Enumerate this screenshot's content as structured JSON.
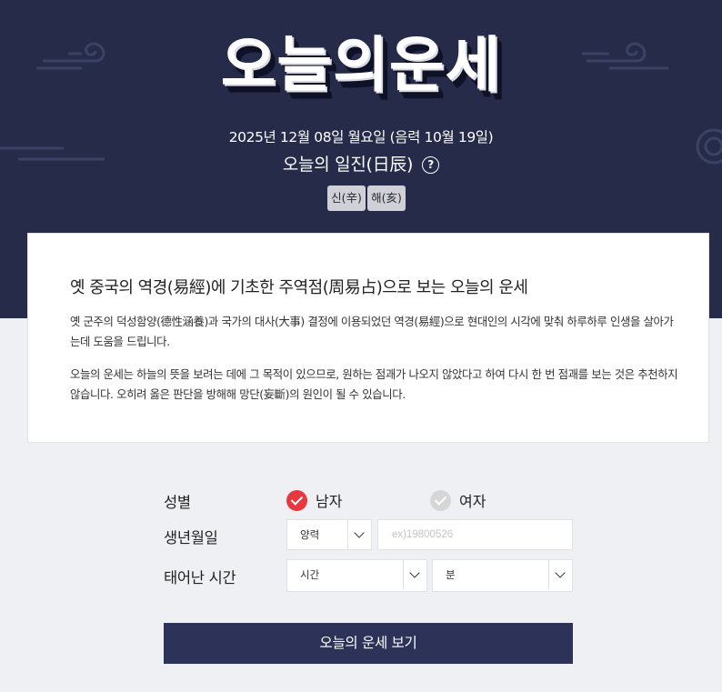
{
  "header": {
    "title": "오늘의운세",
    "date_line": "2025년 12월 08일 월요일 (음력 10월 19일)",
    "iljin_label": "오늘의 일진(日辰)",
    "help_icon": "question-circle-icon",
    "chips": [
      "신(辛)",
      "해(亥)"
    ]
  },
  "info": {
    "heading": "옛 중국의 역경(易經)에 기초한 주역점(周易占)으로 보는 오늘의 운세",
    "paragraph1": "옛 군주의 덕성함양(德性涵養)과 국가의 대사(大事) 결정에 이용되었던 역경(易經)으로 현대인의 시각에 맞춰 하루하루 인생을 살아가는데 도움을 드립니다.",
    "paragraph2": "오늘의 운세는 하늘의 뜻을 보려는 데에 그 목적이 있으므로, 원하는 점괘가 나오지 않았다고 하여 다시 한 번 점괘를 보는 것은 추천하지 않습니다. 오히려 옳은 판단을 방해해 망단(妄斷)의 원인이 될 수 있습니다."
  },
  "form": {
    "gender_label": "성별",
    "male_label": "남자",
    "female_label": "여자",
    "selected_gender": "남자",
    "birth_label": "생년월일",
    "calendar_select": "양력",
    "birth_placeholder": "ex)19800526",
    "time_label": "태어난 시간",
    "hour_select": "시간",
    "minute_select": "분",
    "submit_label": "오늘의 운세 보기"
  },
  "colors": {
    "hero_bg": "#262b4a",
    "button_bg": "#2d3358",
    "radio_on": "#e8373f",
    "radio_off": "#d6d6d6"
  }
}
